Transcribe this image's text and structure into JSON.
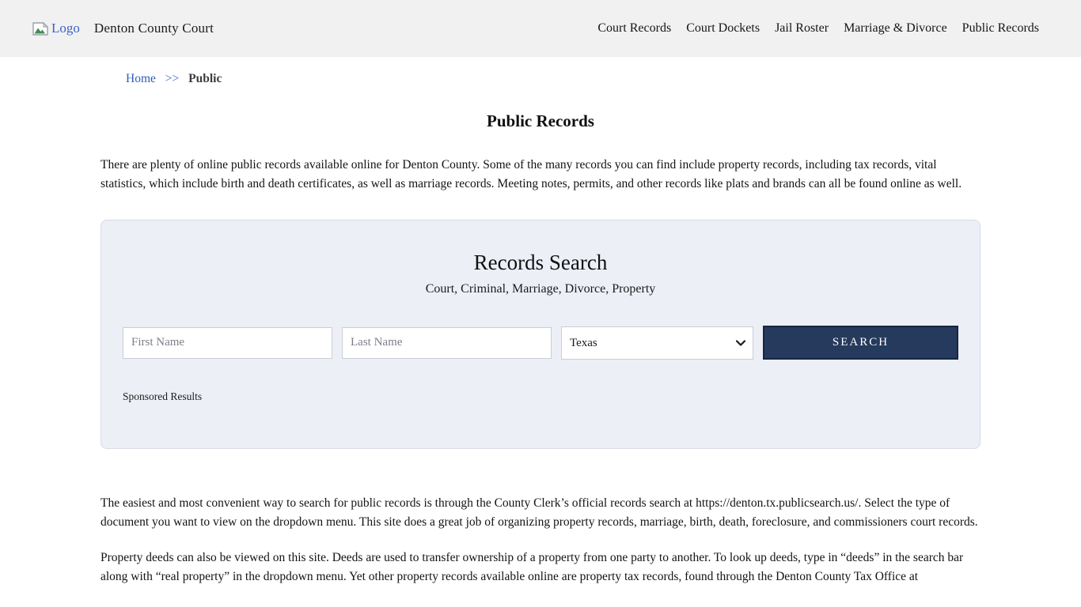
{
  "header": {
    "logo_alt": "Logo",
    "site_title": "Denton County Court",
    "nav": [
      {
        "label": "Court Records"
      },
      {
        "label": "Court Dockets"
      },
      {
        "label": "Jail Roster"
      },
      {
        "label": "Marriage & Divorce"
      },
      {
        "label": "Public Records"
      }
    ]
  },
  "breadcrumb": {
    "home": "Home",
    "separator": ">>",
    "current": "Public"
  },
  "page": {
    "title": "Public Records",
    "intro": "There are plenty of online public records available online for Denton County. Some of the many records you can find include property records, including tax records, vital statistics, which include birth and death certificates, as well as marriage records. Meeting notes, permits, and other records like plats and brands can all be found online as well.",
    "para_clerk": "The easiest and most convenient way to search for public records is through the County Clerk’s official records search at https://denton.tx.publicsearch.us/. Select the type of document you want to view on the dropdown menu. This site does a great job of organizing property records, marriage, birth, death, foreclosure, and commissioners court records.",
    "para_deeds": "Property deeds can also be viewed on this site. Deeds are used to transfer ownership of a property from one party to another. To look up deeds, type in “deeds” in the search bar along with “real property” in the dropdown menu. Yet other property records available online are property tax records, found through the Denton County Tax Office at"
  },
  "search": {
    "title": "Records Search",
    "subtitle": "Court, Criminal, Marriage, Divorce, Property",
    "first_name_placeholder": "First Name",
    "last_name_placeholder": "Last Name",
    "state_selected": "Texas",
    "button_label": "SEARCH",
    "sponsored_label": "Sponsored Results"
  },
  "colors": {
    "header_bg": "#f1f1f2",
    "panel_bg": "#edeff7",
    "panel_border": "#d9dbe4",
    "button_bg": "#253a5c",
    "button_border": "#172742",
    "link_blue": "#2e5cb8",
    "alt_text_blue": "#3a62c5"
  }
}
